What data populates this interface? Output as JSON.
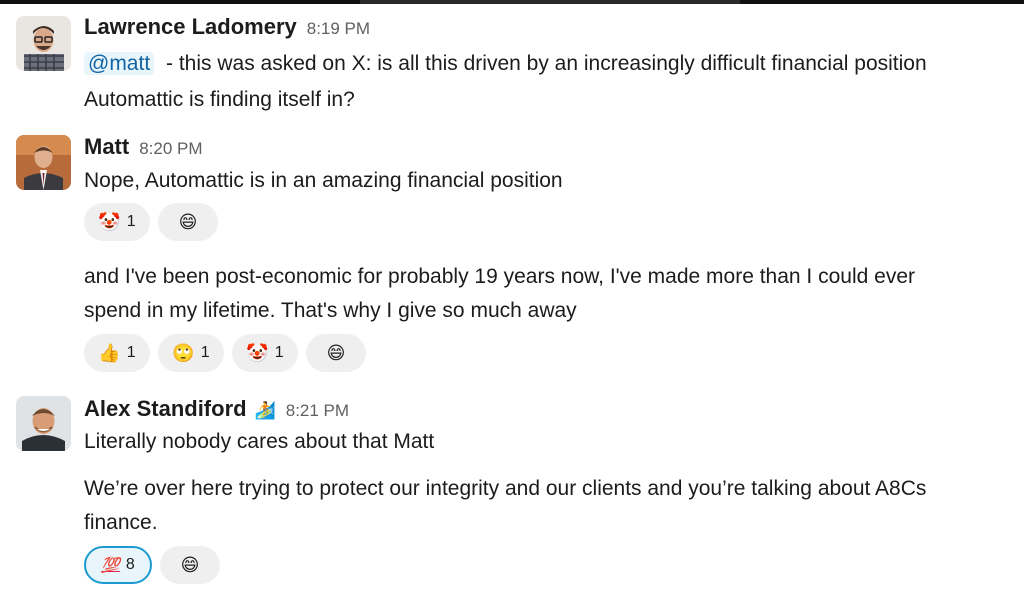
{
  "messages": [
    {
      "author": "Lawrence Ladomery",
      "time": "8:19 PM",
      "mention": "@matt",
      "text_line1": " - this was asked on X: is all this driven by an increasingly difficult financial position",
      "text_line2": "Automattic is finding itself in?"
    },
    {
      "author": "Matt",
      "time": "8:20 PM",
      "text": "Nope, Automattic is in an amazing financial position",
      "reactions": [
        {
          "emoji": "🤡",
          "count": "1",
          "icon": "clown-face-icon"
        }
      ],
      "followup_line1": "and I've been post-economic for probably 19 years now, I've made more than I could ever",
      "followup_line2": "spend in my lifetime. That's why I give so much away",
      "followup_reactions": [
        {
          "emoji": "👍",
          "count": "1",
          "icon": "thumbs-up-icon"
        },
        {
          "emoji": "🙄",
          "count": "1",
          "icon": "eye-roll-icon"
        },
        {
          "emoji": "🤡",
          "count": "1",
          "icon": "clown-face-icon"
        }
      ]
    },
    {
      "author": "Alex Standiford",
      "status_emoji": "🏄",
      "time": "8:21 PM",
      "text": "Literally nobody cares about that Matt",
      "followup_line1": "We’re over here trying to protect our integrity and our clients and you’re talking about A8Cs",
      "followup_line2": "finance.",
      "reactions": [
        {
          "emoji": "💯",
          "count": "8",
          "icon": "hundred-points-icon",
          "selected": true
        }
      ]
    }
  ],
  "add_reaction_icon": "😄",
  "colors": {
    "mention_bg": "#e8f5fa",
    "mention_text": "#1264a3",
    "reaction_bg": "#efefef",
    "selected_border": "#1d9bd1"
  }
}
